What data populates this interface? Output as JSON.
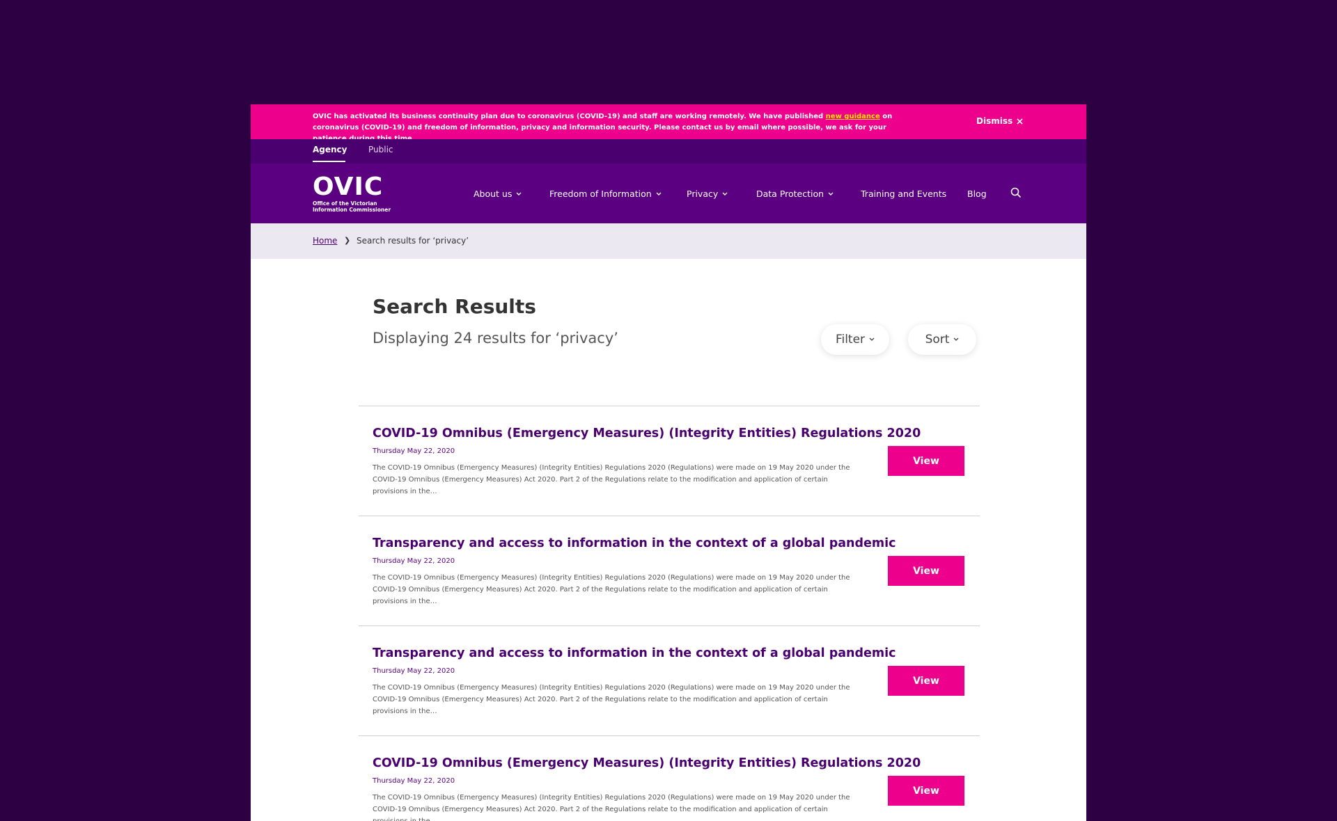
{
  "alert": {
    "text_before": "OVIC has activated its business continuity plan due to coronavirus (COVID-19) and staff are working remotely. We have published ",
    "link": "new guidance",
    "text_after": " on coronavirus (COVID-19) and freedom of information, privacy and information security. Please contact us by email where possible, we ask for your patience during this time.",
    "dismiss": "Dismiss"
  },
  "audience": {
    "tabs": [
      "Agency",
      "Public"
    ]
  },
  "logo": {
    "word": "OVIC",
    "line1": "Office of the Victorian",
    "line2": "Information Commissioner"
  },
  "nav": {
    "items": [
      "About us",
      "Freedom of Information",
      "Privacy",
      "Data Protection",
      "Training and Events",
      "Blog"
    ],
    "search_icon": "search-icon"
  },
  "breadcrumb": {
    "home": "Home",
    "current": "Search results for ‘privacy’"
  },
  "page": {
    "title": "Search Results",
    "subtitle": "Displaying 24 results for ‘privacy’",
    "filter": "Filter",
    "sort": "Sort"
  },
  "results": [
    {
      "title": "COVID-19 Omnibus (Emergency Measures) (Integrity Entities) Regulations 2020",
      "date": "Thursday May 22, 2020",
      "desc": "The COVID-19 Omnibus (Emergency Measures) (Integrity Entities) Regulations 2020 (Regulations) were made on 19 May 2020 under the COVID-19 Omnibus (Emergency Measures) Act 2020. Part 2 of the Regulations relate to the modification and application of certain provisions in the…",
      "button": "View"
    },
    {
      "title": "Transparency and access to information in the context of a global pandemic",
      "date": "Thursday May 22, 2020",
      "desc": "The COVID-19 Omnibus (Emergency Measures) (Integrity Entities) Regulations 2020 (Regulations) were made on 19 May 2020 under the COVID-19 Omnibus (Emergency Measures) Act 2020. Part 2 of the Regulations relate to the modification and application of certain provisions in the…",
      "button": "View"
    },
    {
      "title": "Transparency and access to information in the context of a global pandemic",
      "date": "Thursday May 22, 2020",
      "desc": "The COVID-19 Omnibus (Emergency Measures) (Integrity Entities) Regulations 2020 (Regulations) were made on 19 May 2020 under the COVID-19 Omnibus (Emergency Measures) Act 2020. Part 2 of the Regulations relate to the modification and application of certain provisions in the…",
      "button": "View"
    },
    {
      "title": "COVID-19 Omnibus (Emergency Measures) (Integrity Entities) Regulations 2020",
      "date": "Thursday May 22, 2020",
      "desc": "The COVID-19 Omnibus (Emergency Measures) (Integrity Entities) Regulations 2020 (Regulations) were made on 19 May 2020 under the COVID-19 Omnibus (Emergency Measures) Act 2020. Part 2 of the Regulations relate to the modification and application of certain provisions in the…",
      "button": "View"
    }
  ],
  "colors": {
    "background": "#2c0042",
    "alert": "#ec008c",
    "nav": "#5b0081",
    "audience": "#4a006e",
    "accent": "#ec008c",
    "link": "#ffe000"
  }
}
